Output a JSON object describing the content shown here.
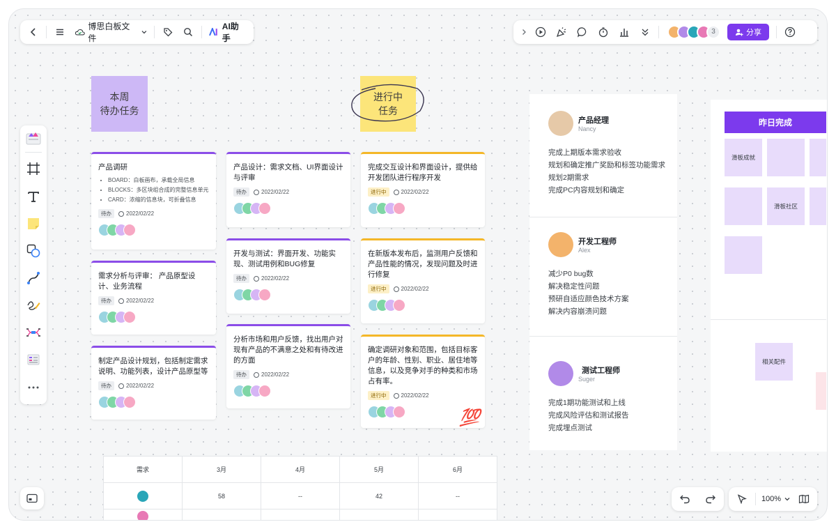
{
  "toolbar_left": {
    "file_name": "博思白板文件",
    "ai_label": "AI助手"
  },
  "toolbar_right": {
    "user_count": "3",
    "share_label": "分享"
  },
  "colors": {
    "accent": "#7c3aed",
    "sticky_purple": "#cdb8f6",
    "sticky_yellow": "#fce57a",
    "card_purple": "#8b4de8",
    "card_yellow": "#f4b728"
  },
  "stickies": {
    "todo": "本周\n待办任务",
    "doing": "进行中\n任务"
  },
  "cards": [
    {
      "title": "产品调研",
      "bullets": [
        "BOARD：白板画布，承载全局信息",
        "BLOCKS：多区块组合成的完整信息单元",
        "CARD：浓缩的信息块，可折叠信息"
      ],
      "tag": "待办",
      "date": "2022/02/22"
    },
    {
      "title": "需求分析与评审： 产品原型设计、业务流程",
      "tag": "待办",
      "date": "2022/02/22"
    },
    {
      "title": "制定产品设计规划，包括制定需求说明、功能列表，设计产品原型等",
      "tag": "待办",
      "date": "2022/02/22"
    },
    {
      "title": "产品设计：需求文档、UI界面设计与评审",
      "tag": "待办",
      "date": "2022/02/22"
    },
    {
      "title": "开发与测试：界面开发、功能实现、测试用例和BUG修复",
      "tag": "待办",
      "date": "2022/02/22"
    },
    {
      "title": "分析市场和用户反馈，找出用户对现有产品的不满意之处和有待改进的方面",
      "tag": "待办",
      "date": "2022/02/22"
    },
    {
      "title": "完成交互设计和界面设计，提供给开发团队进行程序开发",
      "tag": "进行中",
      "date": "2022/02/22"
    },
    {
      "title": "在新版本发布后，监测用户反馈和产品性能的情况，发现问题及时进行修复",
      "tag": "进行中",
      "date": "2022/02/22"
    },
    {
      "title": "确定调研对象和范围，包括目标客户的年龄、性别、职业、居住地等信息，以及竞争对手的种类和市场占有率。",
      "tag": "进行中",
      "date": "2022/02/22"
    }
  ],
  "emoji_100": "💯",
  "roles": [
    {
      "title": "产品经理",
      "name": "Nancy",
      "tasks": [
        "完成上期版本需求验收",
        "规划和确定推广奖励和标签功能需求",
        "规划2期需求",
        "完成PC内容规划和确定"
      ]
    },
    {
      "title": "开发工程师",
      "name": "Alex",
      "tasks": [
        "减少P0 bug数",
        "解决稳定性问题",
        "预研自适应颜色技术方案",
        "解决内容崩溃问题"
      ]
    },
    {
      "title": "测试工程师",
      "name": "Suger",
      "tasks": [
        "完成1期功能测试和上线",
        "完成风险评估和测试报告",
        "完成埋点测试"
      ]
    }
  ],
  "yesterday": {
    "header": "昨日完成",
    "notes": [
      "滑板成就",
      "滑板社区",
      "相关配件"
    ]
  },
  "table": {
    "headers": [
      "需求",
      "3月",
      "4月",
      "5月",
      "6月"
    ],
    "row1": [
      "58",
      "--",
      "42",
      "--"
    ]
  },
  "zoom": "100%"
}
